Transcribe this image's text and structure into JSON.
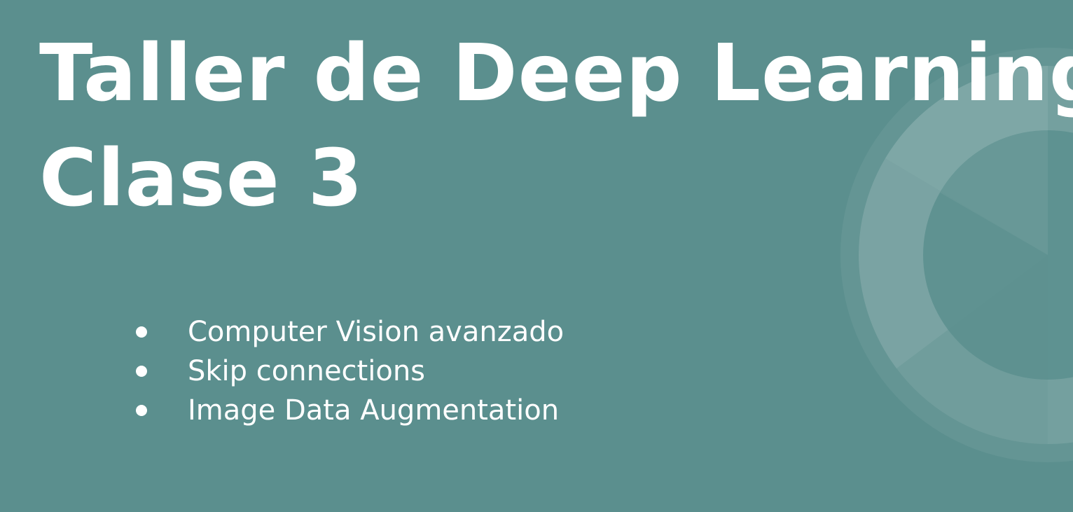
{
  "slide": {
    "title_line1": "Taller de Deep Learning",
    "title_line2": "Clase 3",
    "bullets": [
      "Computer Vision avanzado",
      "Skip connections",
      "Image Data Augmentation"
    ]
  },
  "colors": {
    "background": "#5b8f8e",
    "text": "#ffffff",
    "decoration": "#ffffff"
  }
}
